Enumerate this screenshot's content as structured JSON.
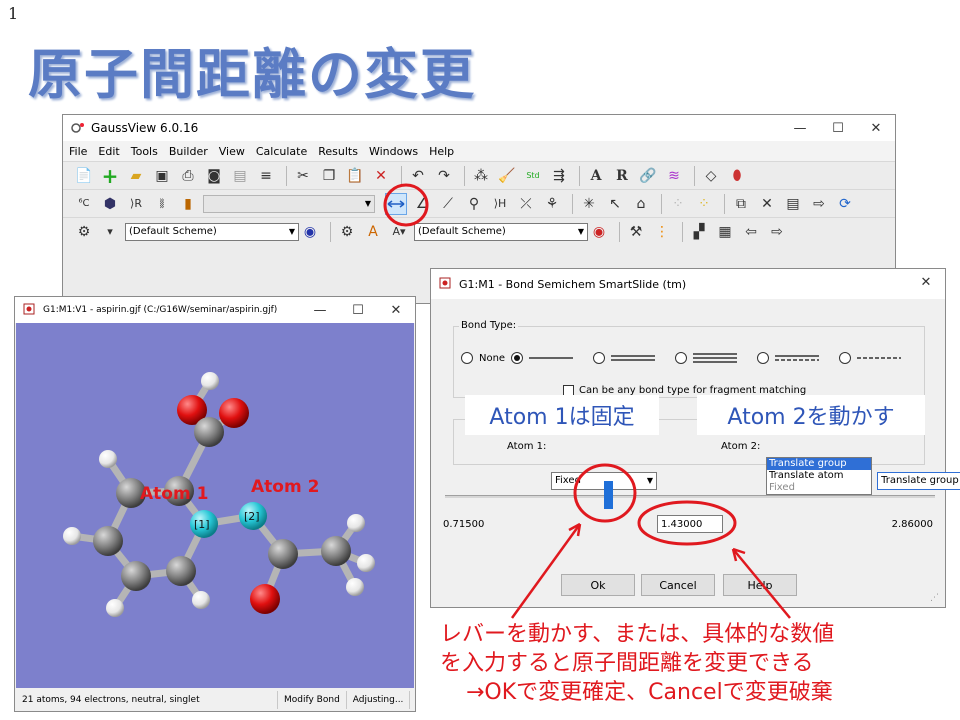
{
  "slide": {
    "number": "1",
    "title": "原子間距離の変更"
  },
  "gaussview": {
    "title": "GaussView 6.0.16",
    "window_buttons": [
      "—",
      "☐",
      "✕"
    ],
    "menu": [
      "File",
      "Edit",
      "Tools",
      "Builder",
      "View",
      "Calculate",
      "Results",
      "Windows",
      "Help"
    ],
    "scheme1": "(Default Scheme)",
    "scheme2": "(Default Scheme)"
  },
  "molecule_window": {
    "title": "G1:M1:V1 - aspirin.gjf (C:/G16W/seminar/aspirin.gjf)",
    "window_buttons": [
      "—",
      "☐",
      "✕"
    ],
    "atom1_label": "Atom 1",
    "atom2_label": "Atom 2",
    "atom1_tag": "[1]",
    "atom2_tag": "[2]",
    "status": [
      "21 atoms, 94 electrons, neutral, singlet",
      "Modify Bond",
      "Adjusting..."
    ]
  },
  "dialog": {
    "title": "G1:M1 - Bond Semichem SmartSlide (tm)",
    "close": "✕",
    "bond_type_label": "Bond Type:",
    "none_label": "None",
    "checkbox_label": "Can be any bond type for fragment matching",
    "annot_atom1": "Atom 1は固定",
    "annot_atom2": "Atom 2を動かす",
    "atom1_field_label": "Atom 1:",
    "atom1_value": "Fixed",
    "atom2_field_label": "Atom 2:",
    "atom2_value": "Translate group",
    "atom2_options": [
      "Translate group",
      "Translate atom",
      "Fixed"
    ],
    "slider_min": "0.71500",
    "slider_max": "2.86000",
    "distance_value": "1.43000",
    "slider_fraction": 0.333,
    "ok": "Ok",
    "cancel": "Cancel",
    "help": "Help"
  },
  "caption": {
    "line1": "レバーを動かす、または、具体的な数値",
    "line2": "を入力すると原子間距離を変更できる",
    "line3": "→OKで変更確定、Cancelで変更破棄"
  },
  "colors": {
    "title_blue": "#5b7cc4",
    "annotation_red": "#e0191f",
    "viewport_bg": "#7d80cc",
    "oxygen": "#e01010",
    "carbon": "#808080",
    "hydrogen": "#f2f2f2",
    "selected_atom": "#27c7d6"
  }
}
